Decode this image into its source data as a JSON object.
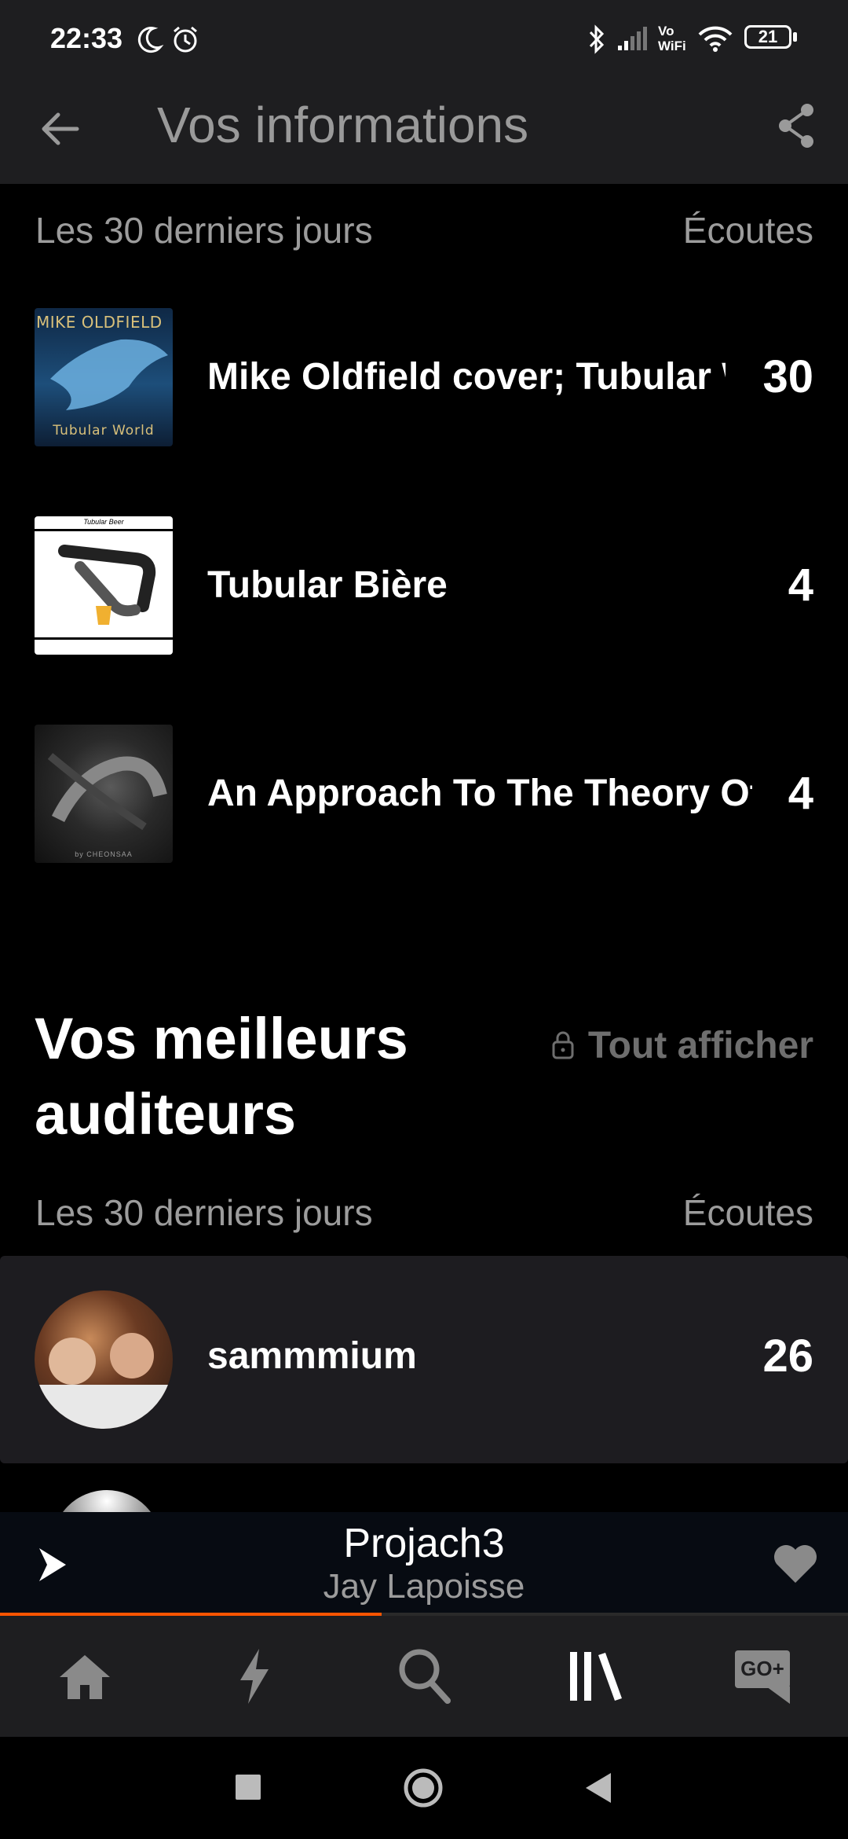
{
  "status_bar": {
    "time": "22:33",
    "battery": "21",
    "volte_label": "Vo\nWiFi"
  },
  "app_bar": {
    "title": "Vos informations"
  },
  "tracks_section": {
    "period_label": "Les 30 derniers jours",
    "column_label": "Écoutes",
    "tracks": [
      {
        "title": "Mike Oldfield cover; Tubular World",
        "plays": "30",
        "art_top_text": "MIKE OLDFIELD",
        "art_bottom_text": "Tubular World"
      },
      {
        "title": "Tubular Bière",
        "plays": "4",
        "art_top_text": "Tubular Beer"
      },
      {
        "title": "An Approach To The Theory Of",
        "plays": "4",
        "art_bottom_text": "by CHEONSAA"
      }
    ]
  },
  "listeners_section": {
    "title": "Vos meilleurs auditeurs",
    "see_all_label": "Tout afficher",
    "period_label": "Les 30 derniers jours",
    "column_label": "Écoutes",
    "listeners": [
      {
        "name": "sammmium",
        "plays": "26"
      }
    ]
  },
  "player": {
    "track": "Projach3",
    "artist": "Jay Lapoisse",
    "progress_percent": 45
  },
  "bottom_nav": {
    "items": [
      {
        "icon": "home-icon"
      },
      {
        "icon": "lightning-icon"
      },
      {
        "icon": "search-icon"
      },
      {
        "icon": "library-icon"
      },
      {
        "icon": "go-plus-icon",
        "label": "GO+"
      }
    ]
  },
  "colors": {
    "accent": "#ff5500",
    "bar_bg": "#1e1e20",
    "muted_text": "#9c9c9c"
  }
}
